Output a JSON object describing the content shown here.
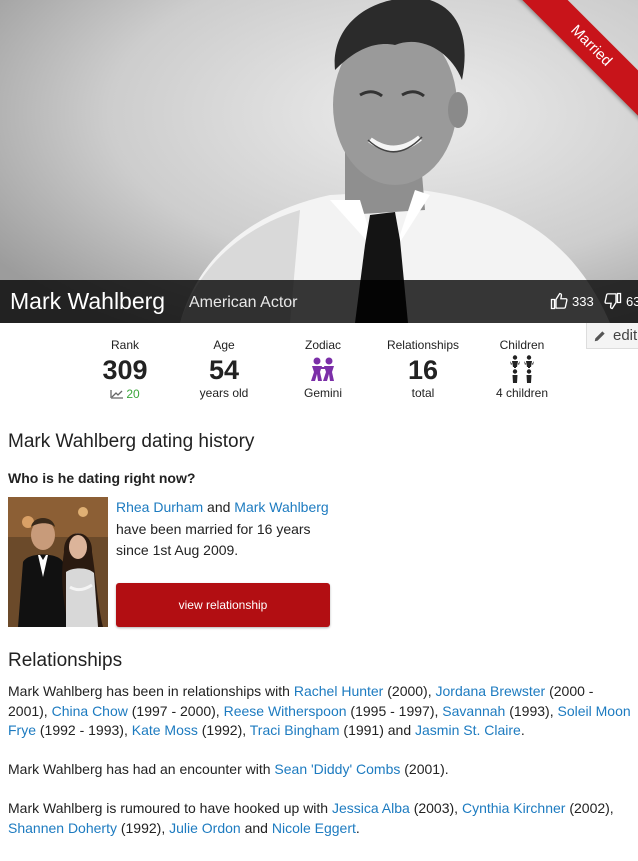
{
  "hero": {
    "name": "Mark Wahlberg",
    "occupation": "American Actor",
    "status_ribbon": "Married",
    "likes": "333",
    "dislikes": "63",
    "edit_label": "edit"
  },
  "stats": {
    "rank": {
      "label": "Rank",
      "value": "309",
      "trend": "20"
    },
    "age": {
      "label": "Age",
      "value": "54",
      "sub": "years old"
    },
    "zodiac": {
      "label": "Zodiac",
      "sub": "Gemini",
      "icon": "gemini-icon"
    },
    "relationships": {
      "label": "Relationships",
      "value": "16",
      "sub": "total"
    },
    "children": {
      "label": "Children",
      "sub": "4 children",
      "icon": "children-icon"
    }
  },
  "dating": {
    "heading": "Mark Wahlberg dating history",
    "question": "Who is he dating right now?",
    "partner": "Rhea Durham",
    "and": "and",
    "self": "Mark Wahlberg",
    "text": "have been married for 16 years since 1st Aug 2009.",
    "button": "view relationship"
  },
  "relationships": {
    "heading": "Relationships",
    "p1_prefix": "Mark Wahlberg has been in relationships with",
    "p1_items": [
      {
        "name": "Rachel Hunter",
        "years": " (2000), "
      },
      {
        "name": "Jordana Brewster",
        "years": " (2000 - 2001), "
      },
      {
        "name": "China Chow",
        "years": " (1997 - 2000), "
      },
      {
        "name": "Reese Witherspoon",
        "years": " (1995 - 1997), "
      },
      {
        "name": "Savannah",
        "years": " (1993), "
      },
      {
        "name": "Soleil Moon Frye",
        "years": " (1992 - 1993), "
      },
      {
        "name": "Kate Moss",
        "years": " (1992), "
      },
      {
        "name": "Traci Bingham",
        "years": " (1991) and "
      },
      {
        "name": "Jasmin St. Claire",
        "years": "."
      }
    ],
    "p2_prefix": "Mark Wahlberg has had an encounter with",
    "p2_name": "Sean 'Diddy' Combs",
    "p2_suffix": " (2001).",
    "p3_prefix": "Mark Wahlberg is rumoured to have hooked up with",
    "p3_items": [
      {
        "name": "Jessica Alba",
        "years": " (2003), "
      },
      {
        "name": "Cynthia Kirchner",
        "years": " (2002), "
      },
      {
        "name": "Shannen Doherty",
        "years": " (1992), "
      },
      {
        "name": "Julie Ordon",
        "years": " and "
      },
      {
        "name": "Nicole Eggert",
        "years": "."
      }
    ]
  },
  "colors": {
    "accent_red": "#b20e12",
    "link_blue": "#1d7bc0",
    "trend_green": "#3aa63a",
    "zodiac_purple": "#7b2fa8"
  }
}
